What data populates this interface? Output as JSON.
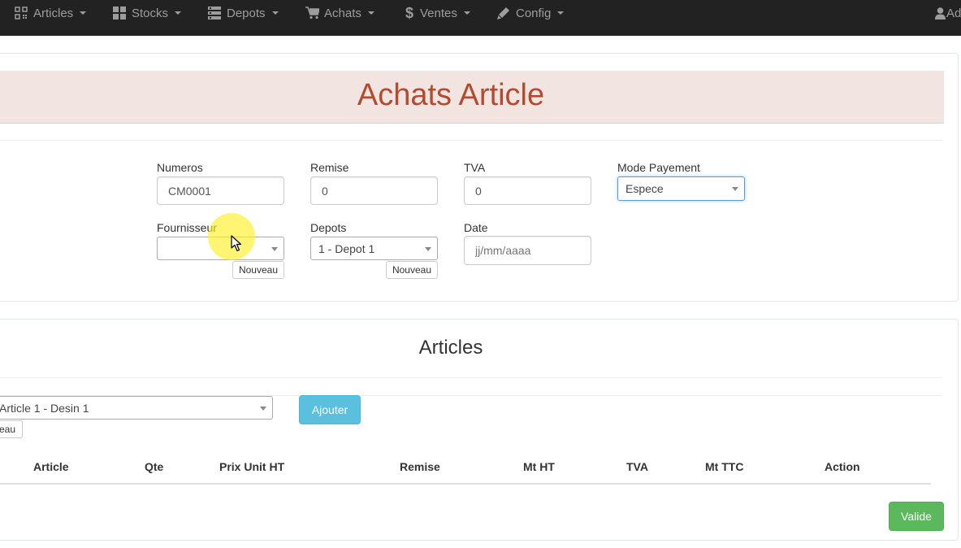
{
  "navbar": {
    "items": [
      {
        "label": "Articles",
        "icon": "qrcode-icon"
      },
      {
        "label": "Stocks",
        "icon": "grid-icon"
      },
      {
        "label": "Depots",
        "icon": "server-icon"
      },
      {
        "label": "Achats",
        "icon": "cart-icon"
      },
      {
        "label": "Ventes",
        "icon": "dollar-icon"
      },
      {
        "label": "Config",
        "icon": "pencil-icon"
      }
    ],
    "user_label": "Ad",
    "background": "#222222"
  },
  "form": {
    "title": "Achats Article",
    "numeros": {
      "label": "Numeros",
      "value": "CM0001"
    },
    "remise": {
      "label": "Remise",
      "value": "0"
    },
    "tva": {
      "label": "TVA",
      "value": "0"
    },
    "mode_payement": {
      "label": "Mode Payement",
      "value": "Espece"
    },
    "fournisseur": {
      "label": "Fournisseur",
      "value": "",
      "new_label": "Nouveau"
    },
    "depots": {
      "label": "Depots",
      "value": "1 - Depot 1",
      "new_label": "Nouveau"
    },
    "date": {
      "label": "Date",
      "placeholder": "jj/mm/aaaa"
    }
  },
  "articles": {
    "title": "Articles",
    "selected_article": "Article 1 - Desin 1",
    "new_label_partial": "eau",
    "add_label": "Ajouter",
    "columns": [
      "Article",
      "Qte",
      "Prix Unit HT",
      "Remise",
      "Mt HT",
      "TVA",
      "Mt TTC",
      "Action"
    ],
    "validate_label": "Valide"
  },
  "colors": {
    "title_text": "#b24b2f",
    "title_bg": "#f2e4e0",
    "info_button": "#5bc0de",
    "success_button": "#5cb85c"
  }
}
